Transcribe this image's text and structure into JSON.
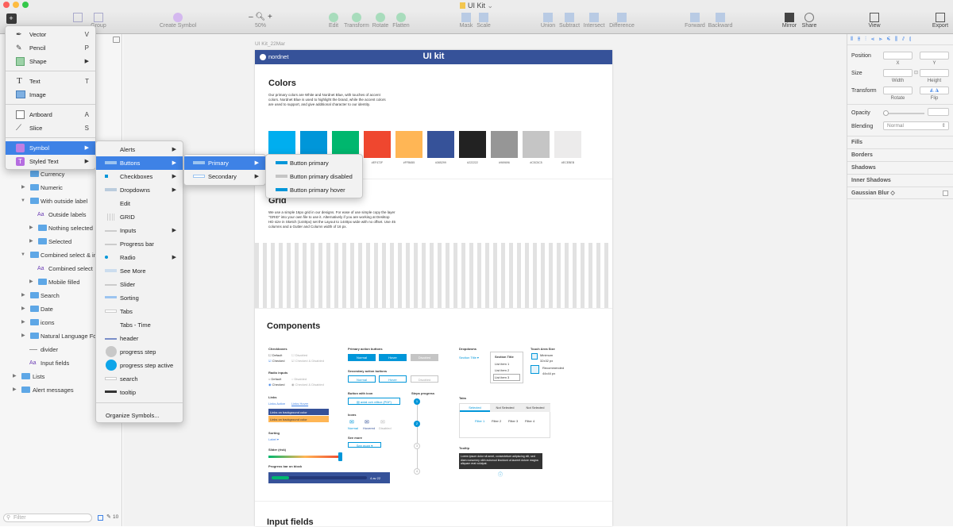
{
  "window": {
    "title": "UI Kit"
  },
  "toolbar": {
    "group": "Group",
    "create_symbol": "Create Symbol",
    "zoom": "50%",
    "edit": "Edit",
    "transform": "Transform",
    "rotate": "Rotate",
    "flatten": "Flatten",
    "mask": "Mask",
    "scale": "Scale",
    "union": "Union",
    "subtract": "Subtract",
    "intersect": "Intersect",
    "difference": "Difference",
    "forward": "Forward",
    "backward": "Backward",
    "mirror": "Mirror",
    "share": "Share",
    "view": "View",
    "export": "Export"
  },
  "insert_menu": [
    {
      "label": "Vector",
      "key": "V",
      "icon": "vector-icon"
    },
    {
      "label": "Pencil",
      "key": "P",
      "icon": "pencil-icon"
    },
    {
      "label": "Shape",
      "key": "",
      "icon": "shape-icon",
      "submenu": true
    },
    {
      "label": "Text",
      "key": "T",
      "icon": "text-icon"
    },
    {
      "label": "Image",
      "key": "",
      "icon": "image-icon"
    },
    {
      "label": "Artboard",
      "key": "A",
      "icon": "artboard-icon"
    },
    {
      "label": "Slice",
      "key": "S",
      "icon": "slice-icon"
    },
    {
      "label": "Symbol",
      "key": "",
      "icon": "symbol-icon",
      "submenu": true
    },
    {
      "label": "Styled Text",
      "key": "",
      "icon": "styled-text-icon",
      "submenu": true
    }
  ],
  "symbol_menu": [
    "Alerts",
    "Buttons",
    "Checkboxes",
    "Dropdowns",
    "Edit",
    "GRID",
    "Inputs",
    "Progress bar",
    "Radio",
    "See More",
    "Slider",
    "Sorting",
    "Tabs",
    "Tabs - Time",
    "header",
    "progress step",
    "progress step active",
    "search",
    "tooltip",
    "Organize Symbols..."
  ],
  "buttons_menu": [
    "Primary",
    "Secondary"
  ],
  "primary_menu": [
    "Button primary",
    "Button primary disabled",
    "Button primary hover"
  ],
  "layers": [
    {
      "label": "Currency"
    },
    {
      "label": "Numeric"
    },
    {
      "label": "With outside label"
    },
    {
      "label": "Outside labels"
    },
    {
      "label": "Nothing selected"
    },
    {
      "label": "Selected"
    },
    {
      "label": "Combined select & in"
    },
    {
      "label": "Combined select"
    },
    {
      "label": "Mobile filled"
    },
    {
      "label": "Search"
    },
    {
      "label": "Date"
    },
    {
      "label": "icons"
    },
    {
      "label": "Natural Language Fo"
    },
    {
      "label": "divider"
    },
    {
      "label": "Input fields"
    },
    {
      "label": "Lists"
    },
    {
      "label": "Alert messages"
    }
  ],
  "filter": {
    "placeholder": "Filter",
    "count": "10"
  },
  "artboard": {
    "name": "UI Kit_22Mar",
    "brand": "nordnet",
    "header_title": "UI kit",
    "colors_title": "Colors",
    "colors_text": "Our primary colors are White and Nordnet Blue, with touches of accent colors. Nordnet Blue is used to highlight the brand, while the accent colors are used to support, and give additional character to our identity.",
    "swatches": [
      {
        "hex": "#00AEEF",
        "label": ""
      },
      {
        "hex": "#0096D9",
        "label": ""
      },
      {
        "hex": "#00B76E",
        "label": ""
      },
      {
        "hex": "#EF472F",
        "label": "#EF472F"
      },
      {
        "hex": "#FFB655",
        "label": "#FFB655"
      },
      {
        "hex": "#365299",
        "label": "#365299"
      },
      {
        "hex": "#222222",
        "label": "#222222"
      },
      {
        "hex": "#969696",
        "label": "#969696"
      },
      {
        "hex": "#C5C5C5",
        "label": "#C5C5C5"
      },
      {
        "hex": "#ECEBEB",
        "label": "#ECEBEB"
      }
    ],
    "grid_title": "Grid",
    "grid_text": "We use a simple 16px grid in our designs. For ease of use simple copy the layer \"GRID\" into your own file to use it. Alternatively if you are working at Desktop HD size in Sketch (1440px) set the Layout to 1440px wide with no offset. Use 45 columns and a Gutter and Column width of 16 px.",
    "components_title": "Components",
    "input_fields_title": "Input fields",
    "comp": {
      "checkboxes": "Checkboxes",
      "default": "Default",
      "checked": "Checked",
      "disabled": "Disabled",
      "checked_disabled": "Checked & Disabled",
      "radio_inputs": "Radio inputs",
      "links": "Links",
      "links_active": "Links Active",
      "links_hover": "Links Hover",
      "link_bg1": "Links on background color",
      "link_bg2": "Links on background color",
      "sorting": "Sorting",
      "sort_label": "Label ▾",
      "slider": "Slider (risk)",
      "progress_bar": "Progress bar on block",
      "progress_text": "4 av 22",
      "primary_buttons": "Primary action buttons",
      "normal": "Normal",
      "hover": "Hover",
      "disabled_btn": "Disabled",
      "secondary_buttons": "Secondary action buttons",
      "button_with_icon": "Button with icon",
      "icon_btn_text": "avtal och villkor (PDF)",
      "icons": "Icons",
      "icon_normal": "Normal",
      "icon_hover": "Hovered",
      "icon_disabled": "Disabled",
      "see_more": "See more",
      "see_more_btn": "See more ▾",
      "steps_progress": "Steps progress",
      "steps": [
        "1",
        "2",
        "3",
        "4"
      ],
      "dropdowns": "Dropdowns",
      "section_title_dd": "Section Title",
      "section_title": "Section Title",
      "list_items": [
        "List item 1",
        "List item 2",
        "List item 3"
      ],
      "touch_area": "Touch Area Size",
      "minimum": "Minimum",
      "min_size": "32x32 px",
      "recommended": "Recommended",
      "rec_size": "44x44 px",
      "tabs": "Tabs",
      "tab_items": [
        "Selected",
        "Not Selected",
        "Not Selected"
      ],
      "filters": [
        "Filter 1",
        "Filter 2",
        "Filter 3",
        "Filter 4"
      ],
      "tooltip": "Tooltip",
      "tooltip_text": "Lorem ipsum dolor sit amet, consectetuer adipiscing elit, sed diam nonummy nibh euismod tincidunt ut laoreet dolore magna aliquam erat volutpat."
    }
  },
  "inspector": {
    "position": "Position",
    "x": "X",
    "y": "Y",
    "size": "Size",
    "width": "Width",
    "height": "Height",
    "transform": "Transform",
    "rotate": "Rotate",
    "flip": "Flip",
    "opacity": "Opacity",
    "blending": "Blending",
    "blending_value": "Normal",
    "fills": "Fills",
    "borders": "Borders",
    "shadows": "Shadows",
    "inner_shadows": "Inner Shadows",
    "gaussian_blur": "Gaussian Blur ◇"
  },
  "colors": {
    "accent": "#3e82e6",
    "nordnet": "#365299",
    "selection": "#3e82e6"
  }
}
